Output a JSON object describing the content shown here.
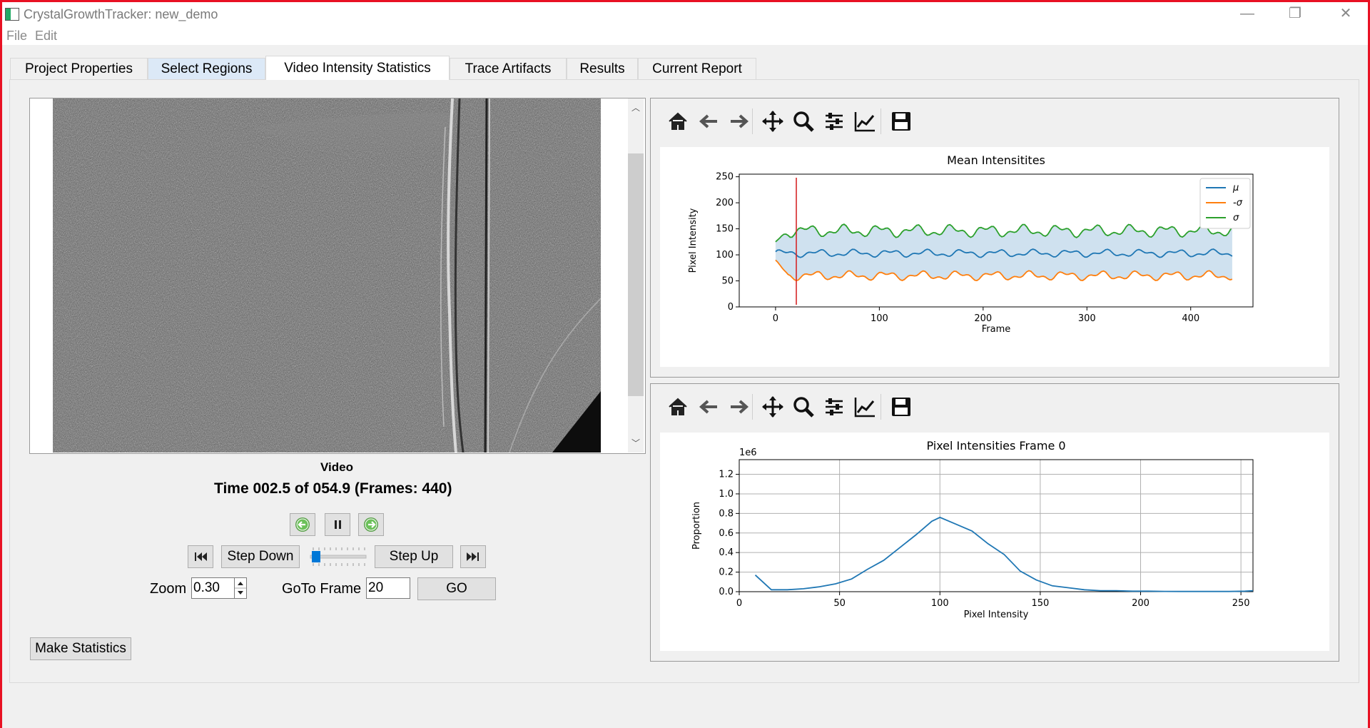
{
  "window": {
    "title": "CrystalGrowthTracker: new_demo",
    "controls": {
      "minimize": "—",
      "restore": "❐",
      "close": "✕"
    }
  },
  "menu": {
    "file": "File",
    "edit": "Edit"
  },
  "tabs": [
    {
      "label": "Project Properties"
    },
    {
      "label": "Select Regions"
    },
    {
      "label": "Video Intensity Statistics"
    },
    {
      "label": "Trace Artifacts"
    },
    {
      "label": "Results"
    },
    {
      "label": "Current Report"
    }
  ],
  "video": {
    "label": "Video",
    "time_text": "Time 002.5 of 054.9 (Frames: 440)",
    "step_down_label": "Step Down",
    "step_up_label": "Step Up",
    "slider_position_fraction": 0.05,
    "zoom_label": "Zoom",
    "zoom_value": "0.30",
    "goto_label": "GoTo Frame",
    "goto_value": "20",
    "go_label": "GO"
  },
  "make_statistics_label": "Make Statistics",
  "toolbar_icons": [
    "home-icon",
    "back-arrow-icon",
    "forward-arrow-icon",
    "pan-icon",
    "zoom-icon",
    "configure-subplots-icon",
    "edit-axis-icon",
    "save-icon"
  ],
  "colors": {
    "mu": "#1f77b4",
    "minus_sigma": "#ff7f0e",
    "sigma": "#2ca02c",
    "fill": "#cfe1ef",
    "marker": "#d62728",
    "accent": "#0078d7"
  },
  "chart_data": [
    {
      "type": "line",
      "title": "Mean Intensitites",
      "xlabel": "Frame",
      "ylabel": "Pixel Intensity",
      "xlim": [
        -35,
        460
      ],
      "ylim": [
        0,
        255
      ],
      "xticks": [
        "0",
        "100",
        "200",
        "300",
        "400"
      ],
      "yticks": [
        "0",
        "50",
        "100",
        "150",
        "200",
        "250"
      ],
      "legend_position": "top-right",
      "marker_line_x": 20,
      "frames": [
        0,
        440
      ],
      "series": [
        {
          "name": "μ",
          "approx_mean": 103,
          "amplitude": 5
        },
        {
          "name": "-σ",
          "approx_mean": 60,
          "amplitude": 6,
          "start_value": 90
        },
        {
          "name": "σ",
          "approx_mean": 146,
          "amplitude": 8,
          "start_value": 125
        }
      ],
      "grid": false
    },
    {
      "type": "line",
      "title": "Pixel Intensities Frame 0",
      "xlabel": "Pixel Intensity",
      "ylabel": "Proportion",
      "y_scale_label": "1e6",
      "xlim": [
        0,
        256
      ],
      "ylim": [
        0,
        1.35
      ],
      "xticks": [
        "0",
        "50",
        "100",
        "150",
        "200",
        "250"
      ],
      "yticks": [
        "0.0",
        "0.2",
        "0.4",
        "0.6",
        "0.8",
        "1.0",
        "1.2"
      ],
      "grid": true,
      "x": [
        8,
        16,
        24,
        32,
        40,
        48,
        56,
        64,
        72,
        80,
        88,
        96,
        100,
        108,
        116,
        124,
        132,
        140,
        148,
        156,
        164,
        172,
        180,
        188,
        196,
        204,
        212,
        220,
        228,
        236,
        244,
        252,
        256
      ],
      "y": [
        0.17,
        0.02,
        0.02,
        0.03,
        0.05,
        0.08,
        0.13,
        0.23,
        0.32,
        0.45,
        0.58,
        0.72,
        0.76,
        0.69,
        0.62,
        0.49,
        0.38,
        0.21,
        0.12,
        0.06,
        0.04,
        0.02,
        0.01,
        0.01,
        0.005,
        0.005,
        0.003,
        0.002,
        0.002,
        0.002,
        0.002,
        0.005,
        0.01
      ]
    }
  ]
}
